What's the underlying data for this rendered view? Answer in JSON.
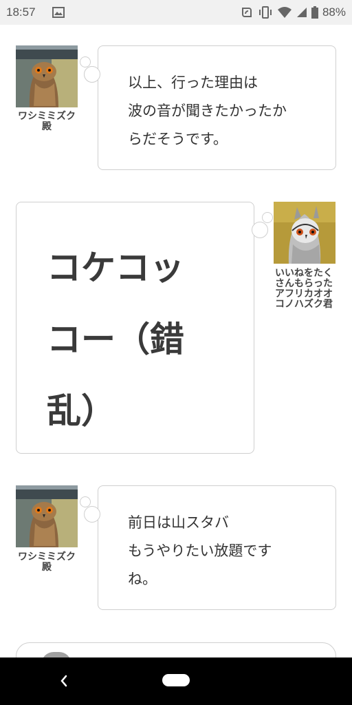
{
  "status": {
    "time": "18:57",
    "battery": "88%"
  },
  "messages": [
    {
      "speaker": "ワシミミズク殿",
      "text": "以上、行った理由は\n波の音が聞きたかったか\nらだそうです。"
    },
    {
      "speaker": "いいねをたくさんもらったアフリカオオコノハズク君",
      "text": "コケコッ\nコー（錯\n乱）"
    },
    {
      "speaker": "ワシミミズク殿",
      "text": "前日は山スタバ\nもうやりたい放題です\nね。"
    }
  ],
  "icons": {
    "nav_back": "back-icon",
    "nav_home": "home-icon"
  },
  "colors": {
    "bubble_border": "#cfcfcf",
    "statusbar_bg": "#f1f1f1",
    "navbar_bg": "#000000"
  }
}
